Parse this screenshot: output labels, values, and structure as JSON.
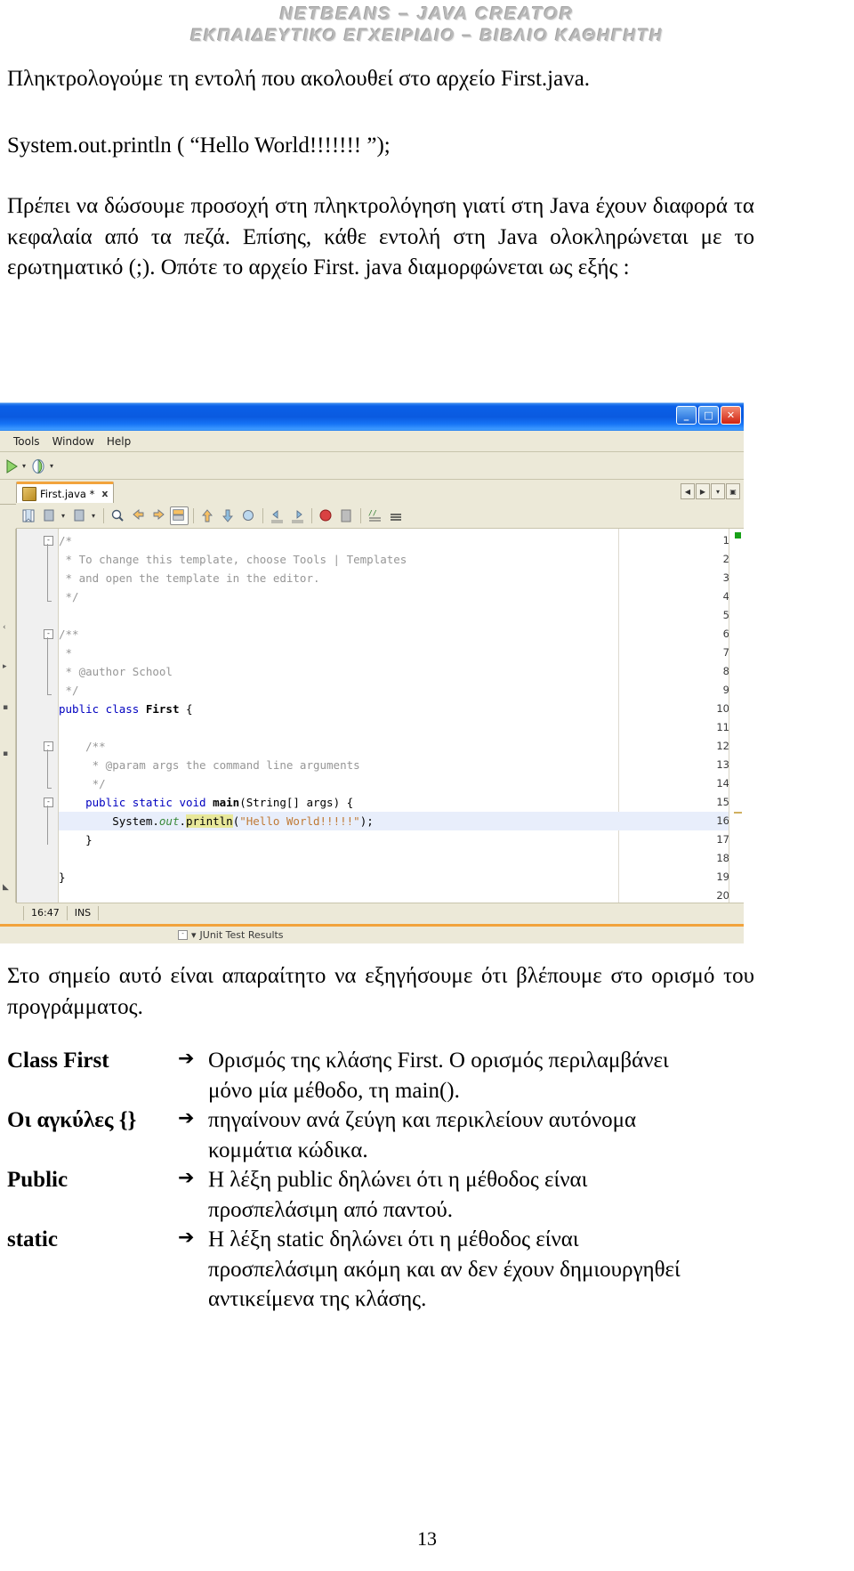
{
  "header": {
    "line1": "NETBEANS – JAVA CREATOR",
    "line2": "ΕΚΠΑΙΔΕΥΤΙΚΟ ΕΓΧΕΙΡΙΔΙΟ – ΒΙΒΛΙΟ ΚΑΘΗΓΗΤΗ"
  },
  "doc_top": {
    "para1": "Πληκτρολογούμε τη εντολή που ακολουθεί στο αρχείο First.java.",
    "code_line": "System.out.println ( “Hello World!!!!!!! ”);",
    "para2": "Πρέπει να δώσουμε προσοχή στη πληκτρολόγηση γιατί στη Java έχουν διαφορά τα κεφαλαία από τα πεζά. Επίσης, κάθε εντολή στη Java ολοκληρώνεται με το ερωτηματικό (;). Οπότε το αρχείο First. java διαμορφώνεται ως εξής :"
  },
  "ide": {
    "window_buttons": [
      "_",
      "□",
      "✕"
    ],
    "menu": [
      "Tools",
      "Window",
      "Help"
    ],
    "tab": {
      "label": "First.java *",
      "close": "x"
    },
    "tabnav": [
      "◀",
      "▶",
      "▾",
      "▣"
    ],
    "editor": {
      "lines": [
        {
          "num": "1",
          "text": "/*",
          "cls": "cmt",
          "fold": "-"
        },
        {
          "num": "2",
          "text": " * To change this template, choose Tools | Templates",
          "cls": "cmt"
        },
        {
          "num": "3",
          "text": " * and open the template in the editor.",
          "cls": "cmt"
        },
        {
          "num": "4",
          "text": " */",
          "cls": "cmt",
          "foldend": true
        },
        {
          "num": "5",
          "text": "",
          "cls": "cmt"
        },
        {
          "num": "6",
          "text": "/**",
          "cls": "cmt",
          "fold": "-"
        },
        {
          "num": "7",
          "text": " *",
          "cls": "cmt"
        },
        {
          "num": "8",
          "text": " * @author School",
          "cls": "cmt"
        },
        {
          "num": "9",
          "text": " */",
          "cls": "cmt",
          "foldend": true
        },
        {
          "num": "10",
          "text": "public class First {",
          "cls": "code10"
        },
        {
          "num": "11",
          "text": "",
          "cls": ""
        },
        {
          "num": "12",
          "text": "    /**",
          "cls": "cmt",
          "fold": "-"
        },
        {
          "num": "13",
          "text": "     * @param args the command line arguments",
          "cls": "cmt"
        },
        {
          "num": "14",
          "text": "     */",
          "cls": "cmt",
          "foldend": true
        },
        {
          "num": "15",
          "text": "    public static void main(String[] args) {",
          "cls": "code15",
          "fold": "-"
        },
        {
          "num": "16",
          "text": "        System.out.println(\"Hello World!!!!!\");",
          "cls": "code16",
          "highlight": true
        },
        {
          "num": "17",
          "text": "    }",
          "cls": ""
        },
        {
          "num": "18",
          "text": "",
          "cls": ""
        },
        {
          "num": "19",
          "text": "}",
          "cls": ""
        },
        {
          "num": "20",
          "text": "",
          "cls": ""
        }
      ],
      "line10": {
        "kw1": "public",
        "kw2": "class",
        "name": "First",
        "brace": "{"
      },
      "line15": {
        "kw1": "public",
        "kw2": "static",
        "kw3": "void",
        "name": "main",
        "args": "(String[] args) {"
      },
      "line16": {
        "sys": "System.",
        "out": "out",
        "dot": ".",
        "println": "println",
        "open": "(",
        "str": "\"Hello World!!!!!\"",
        "close": ");"
      }
    },
    "statusbar": {
      "time": "16:47",
      "mode": "INS"
    },
    "bottom_tab": "JUnit Test Results"
  },
  "doc_bottom": {
    "para3": "Στο σημείο αυτό είναι απαραίτητο να εξηγήσουμε ότι βλέπουμε στο ορισμό του προγράμματος.",
    "definitions": [
      {
        "term": "Class First",
        "arrow": "➔",
        "desc": "Ορισμός της κλάσης First. Ο ορισμός περιλαμβάνει",
        "cont": "μόνο μία μέθοδο, τη main()."
      },
      {
        "term": "Οι αγκύλες {}",
        "arrow": "➔",
        "desc": "πηγαίνουν ανά ζεύγη και περικλείουν αυτόνομα",
        "cont": "κομμάτια κώδικα."
      },
      {
        "term": "Public",
        "arrow": "➔",
        "desc": "Η λέξη public δηλώνει ότι η μέθοδος είναι",
        "cont": "προσπελάσιμη από παντού."
      },
      {
        "term": "static",
        "arrow": "➔",
        "desc": "Η λέξη static δηλώνει ότι η μέθοδος είναι",
        "cont": "προσπελάσιμη ακόμη και αν δεν έχουν δημιουργηθεί αντικείμενα της κλάσης."
      }
    ]
  },
  "page_number": "13",
  "colors": {
    "titlebar_blue": "#0a5ae0",
    "chrome": "#ece9d8",
    "tab_accent": "#f2a33c",
    "keyword": "#0000c0",
    "comment": "#969696",
    "string": "#c07a36",
    "field": "#3a8a3a",
    "highlight_line": "#e8eefb",
    "highlight_token": "#e8e89a",
    "watermark": "#b9b9b9"
  }
}
